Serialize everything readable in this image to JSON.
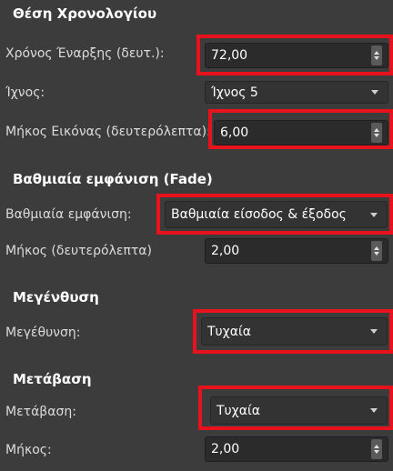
{
  "timeline": {
    "title": "Θέση Χρονολογίου",
    "start_label": "Χρόνος Έναρξης (δευτ.):",
    "start_value": "72,00",
    "track_label": "Ίχνος:",
    "track_value": "Ίχνος 5",
    "length_label": "Μήκος Εικόνας (δευτερόλεπτα):",
    "length_value": "6,00"
  },
  "fade": {
    "title": "Βαθμιαία εμφάνιση (Fade)",
    "fade_label": "Βαθμιαία εμφάνιση:",
    "fade_value": "Βαθμιαία είσοδος & έξοδος",
    "length_label": "Μήκος (δευτερόλεπτα)",
    "length_value": "2,00"
  },
  "zoom": {
    "title": "Μεγένθυση",
    "zoom_label": "Μεγέθυνση:",
    "zoom_value": "Τυχαία"
  },
  "transition": {
    "title": "Μετάβαση",
    "transition_label": "Μετάβαση:",
    "transition_value": "Τυχαία",
    "length_label": "Μήκος:",
    "length_value": "2,00"
  },
  "highlight_color": "#e8121c"
}
